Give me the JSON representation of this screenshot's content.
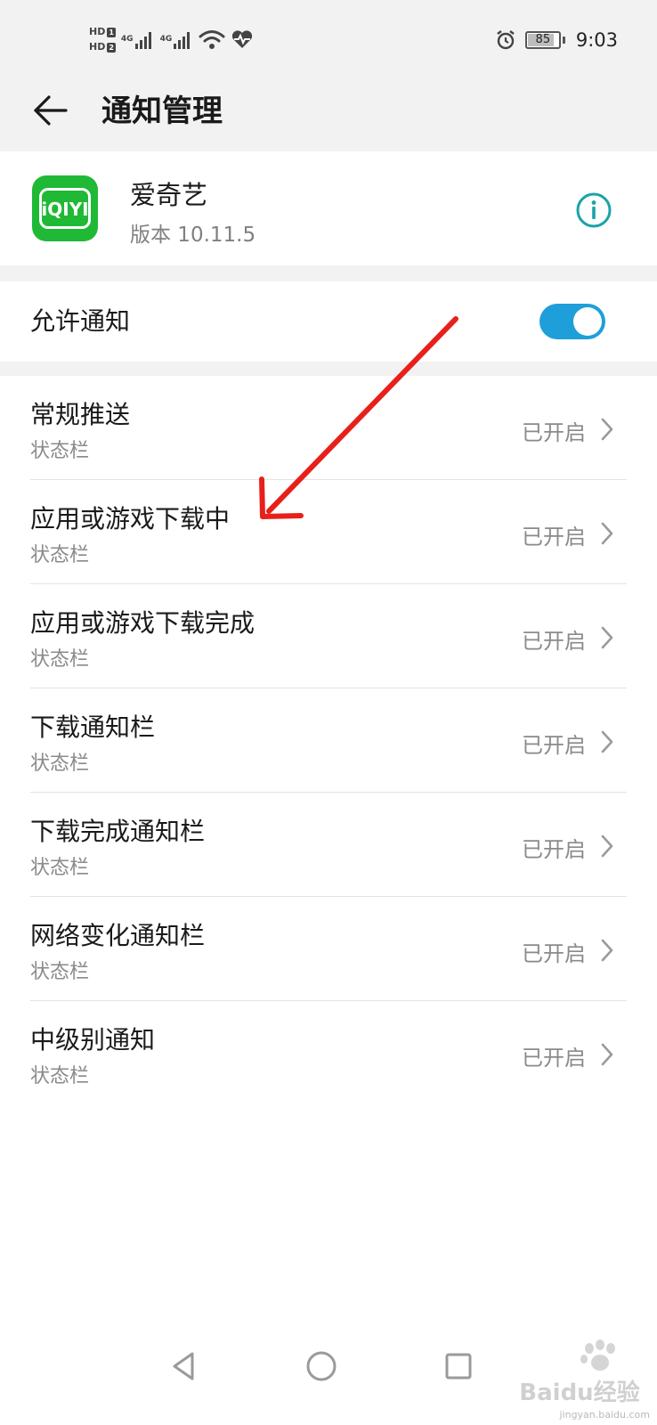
{
  "status_bar": {
    "sim_labels": [
      "HD",
      "HD"
    ],
    "sim_badges": [
      "1",
      "2"
    ],
    "network_types": [
      "4G",
      "4G"
    ],
    "battery_level": "85",
    "time": "9:03",
    "icons": [
      "signal-icon",
      "wifi-icon",
      "heart-rate-icon",
      "alarm-icon",
      "battery-icon"
    ]
  },
  "header": {
    "title": "通知管理",
    "back_icon": "back-arrow-icon"
  },
  "app_info": {
    "name": "爱奇艺",
    "version": "版本 10.11.5",
    "logo_text": "iQIYI",
    "info_icon": "info-icon"
  },
  "allow_notifications": {
    "label": "允许通知",
    "enabled": true
  },
  "channels": [
    {
      "title": "常规推送",
      "subtitle": "状态栏",
      "status": "已开启"
    },
    {
      "title": "应用或游戏下载中",
      "subtitle": "状态栏",
      "status": "已开启"
    },
    {
      "title": "应用或游戏下载完成",
      "subtitle": "状态栏",
      "status": "已开启"
    },
    {
      "title": "下载通知栏",
      "subtitle": "状态栏",
      "status": "已开启"
    },
    {
      "title": "下载完成通知栏",
      "subtitle": "状态栏",
      "status": "已开启"
    },
    {
      "title": "网络变化通知栏",
      "subtitle": "状态栏",
      "status": "已开启"
    },
    {
      "title": "中级别通知",
      "subtitle": "状态栏",
      "status": "已开启"
    }
  ],
  "nav_bar": {
    "icons": [
      "back-triangle-icon",
      "home-circle-icon",
      "recents-square-icon"
    ]
  },
  "watermark": {
    "brand": "Baidu经验",
    "url": "jingyan.baidu.com"
  },
  "colors": {
    "accent": "#1e9fd9",
    "app_logo": "#1fb936",
    "info_icon": "#1aa3a8",
    "annotation_arrow": "#e8201a",
    "background": "#f2f2f2"
  }
}
